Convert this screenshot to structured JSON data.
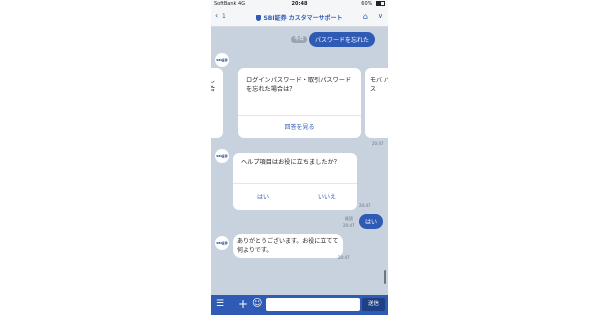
{
  "status_bar": {
    "carrier": "SoftBank",
    "network": "4G",
    "time": "20:48",
    "battery": "60%"
  },
  "header": {
    "back_count": "1",
    "title": "SBI証券 カスタマーサポート"
  },
  "messages": {
    "today": "今日",
    "user_forgot_password": "パスワードを忘れた",
    "bot_avatar": "SBI証券",
    "card_left_text": "型し 場合",
    "card_main_text": "ログインパスワード・取引パスワードを忘れた場合は？",
    "card_main_action": "回答を見る",
    "card_right_text": "モバ パス",
    "card_time": "20:47",
    "help_question": "ヘルプ項目はお役に立ちましたか？",
    "help_yes": "はい",
    "help_no": "いいえ",
    "help_time": "20:47",
    "user_read": "既読",
    "user_time": "20:47",
    "user_yes": "はい",
    "bot_thanks": "ありがとうございます。お役に立てて何よりです。",
    "thanks_time": "20:47"
  },
  "input_bar": {
    "send_label": "送信",
    "placeholder": ""
  }
}
